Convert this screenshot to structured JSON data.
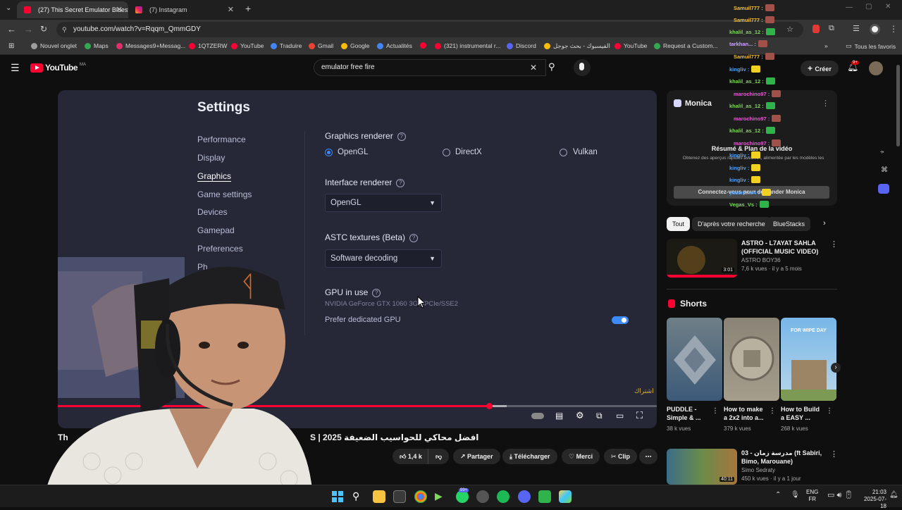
{
  "browser": {
    "tabs": [
      {
        "title": "(27) This Secret Emulator Bluest"
      },
      {
        "title": "(7) Instagram"
      }
    ],
    "url": "youtube.com/watch?v=Rqqm_QmmGDY",
    "bookmarks": [
      "Nouvel onglet",
      "Maps",
      "Messages9+Messag...",
      "1QTZERW",
      "YouTube",
      "Traduire",
      "Gmail",
      "Google",
      "Actualités",
      "(321) instrumental r...",
      "Discord",
      "الفيسبوك - بحث جوجل",
      "YouTube",
      "Request a Custom..."
    ],
    "all_bookmarks": "Tous les favoris"
  },
  "youtube": {
    "logo": "YouTube",
    "logo_region": "MA",
    "search_value": "emulator free fire",
    "create_label": "Créer",
    "notif_count": "9+"
  },
  "video": {
    "settings_title": "Settings",
    "nav": [
      "Performance",
      "Display",
      "Graphics",
      "Game settings",
      "Devices",
      "Gamepad",
      "Preferences",
      "Ph..."
    ],
    "graphics_renderer_label": "Graphics renderer",
    "renderer_options": [
      "OpenGL",
      "DirectX",
      "Vulkan"
    ],
    "interface_renderer_label": "Interface renderer",
    "interface_renderer_value": "OpenGL",
    "astc_label": "ASTC textures (Beta)",
    "astc_value": "Software decoding",
    "gpu_label": "GPU in use",
    "gpu_value": "NVIDIA GeForce GTX 1060 3GB/PCIe/SSE2",
    "prefer_gpu_label": "Prefer dedicated GPU",
    "subscribe_watermark": "اشتراك",
    "progress_fraction": 0.72
  },
  "below_video": {
    "title_prefix": "Th",
    "title_arabic": "افضل محاكي للحواسيب الضعيفة 2025 | S",
    "likes": "1,4 k",
    "share": "Partager",
    "download": "Télécharger",
    "thanks": "Merci",
    "clip": "Clip"
  },
  "chat": [
    {
      "name": "Samuil777 :",
      "color": "#f0c040"
    },
    {
      "name": "Samuil777 :",
      "color": "#f0c040"
    },
    {
      "name": "khalil_as_12 :",
      "color": "#7cd957"
    },
    {
      "name": "tarkhan... :",
      "color": "#c9a6ff"
    },
    {
      "name": "Samuil777 :",
      "color": "#f0c040"
    },
    {
      "name": "kingliv :",
      "color": "#4da3ff"
    },
    {
      "name": "khalil_as_12 :",
      "color": "#7cd957"
    },
    {
      "name": "marochino97 :",
      "color": "#e05fd0"
    },
    {
      "name": "khalil_as_12 :",
      "color": "#7cd957"
    },
    {
      "name": "marochino97 :",
      "color": "#e05fd0"
    },
    {
      "name": "khalil_as_12 :",
      "color": "#7cd957"
    },
    {
      "name": "marochino97 :",
      "color": "#e05fd0"
    },
    {
      "name": "kingliv :",
      "color": "#4da3ff"
    },
    {
      "name": "kingliv :",
      "color": "#4da3ff"
    },
    {
      "name": "kingliv :",
      "color": "#4da3ff"
    },
    {
      "name": "yassmine4 :",
      "color": "#4da3ff"
    },
    {
      "name": "Vegas_Vs :",
      "color": "#7cd957"
    }
  ],
  "monica": {
    "title": "Monica",
    "heading": "Résumé & Plan de la vidéo",
    "desc": "Obtenez des aperçus rapides avec l'IA, alimentée par les modèles les",
    "button": "Connectez-vous pour demander Monica"
  },
  "chips": [
    "Tout",
    "D'après votre recherche",
    "BlueStacks"
  ],
  "recommended": [
    {
      "title": "ASTRO - L7AYAT SAHLA (OFFICIAL MUSIC VIDEO)",
      "channel": "ASTRO BOY36",
      "meta": "7,6 k vues · il y a 5 mois",
      "duration": "3:01"
    },
    {
      "title": "03 - مدرسة زمان (ft Sabiri, Bimo, Marouane)",
      "channel": "Simo Sedraty",
      "meta": "450 k vues · il y a 1 jour",
      "duration": "40:11"
    }
  ],
  "shorts_label": "Shorts",
  "shorts": [
    {
      "title": "PUDDLE - Simple & ...",
      "views": "38 k vues"
    },
    {
      "title": "How to make a 2x2 into a...",
      "views": "379 k vues"
    },
    {
      "title": "How to Build a EASY ...",
      "views": "268 k vues"
    }
  ],
  "shorts_overlay": "FOR WIPE DAY",
  "taskbar": {
    "lang": "ENG",
    "region": "FR",
    "time": "21:03",
    "date": "2025-07-18",
    "badge": "99+"
  }
}
